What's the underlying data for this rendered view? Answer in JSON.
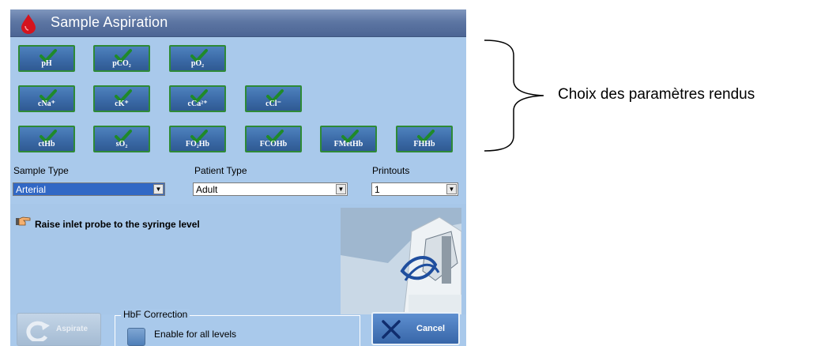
{
  "window": {
    "title": "Sample Aspiration"
  },
  "parameters": [
    {
      "label": "pH",
      "checked": true
    },
    {
      "label": "pCO₂",
      "checked": true
    },
    {
      "label": "pO₂",
      "checked": true
    },
    {
      "label": "cNa⁺",
      "checked": true
    },
    {
      "label": "cK⁺",
      "checked": true
    },
    {
      "label": "cCa²⁺",
      "checked": true
    },
    {
      "label": "cCl⁻",
      "checked": true
    },
    {
      "label": "ctHb",
      "checked": true
    },
    {
      "label": "sO₂",
      "checked": true
    },
    {
      "label": "FO₂Hb",
      "checked": true
    },
    {
      "label": "FCOHb",
      "checked": true
    },
    {
      "label": "FMetHb",
      "checked": true
    },
    {
      "label": "FHHb",
      "checked": true
    }
  ],
  "fields": {
    "sample_type": {
      "label": "Sample Type",
      "value": "Arterial"
    },
    "patient_type": {
      "label": "Patient Type",
      "value": "Adult"
    },
    "printouts": {
      "label": "Printouts",
      "value": "1"
    }
  },
  "instruction": {
    "text": "Raise inlet probe to the syringe level",
    "icon": "pointing-hand-icon"
  },
  "hbf": {
    "group_title": "HbF Correction",
    "checkbox_label": "Enable for all levels",
    "checked": false
  },
  "buttons": {
    "aspirate": "Aspirate",
    "aspirate_enabled": false,
    "cancel": "Cancel"
  },
  "annotation": {
    "text": "Choix des paramètres rendus"
  },
  "colors": {
    "panel": "#a9c9eb",
    "titlebar": "#5d76a3",
    "check": "#2e8a36",
    "button": "#3b6aa7"
  }
}
